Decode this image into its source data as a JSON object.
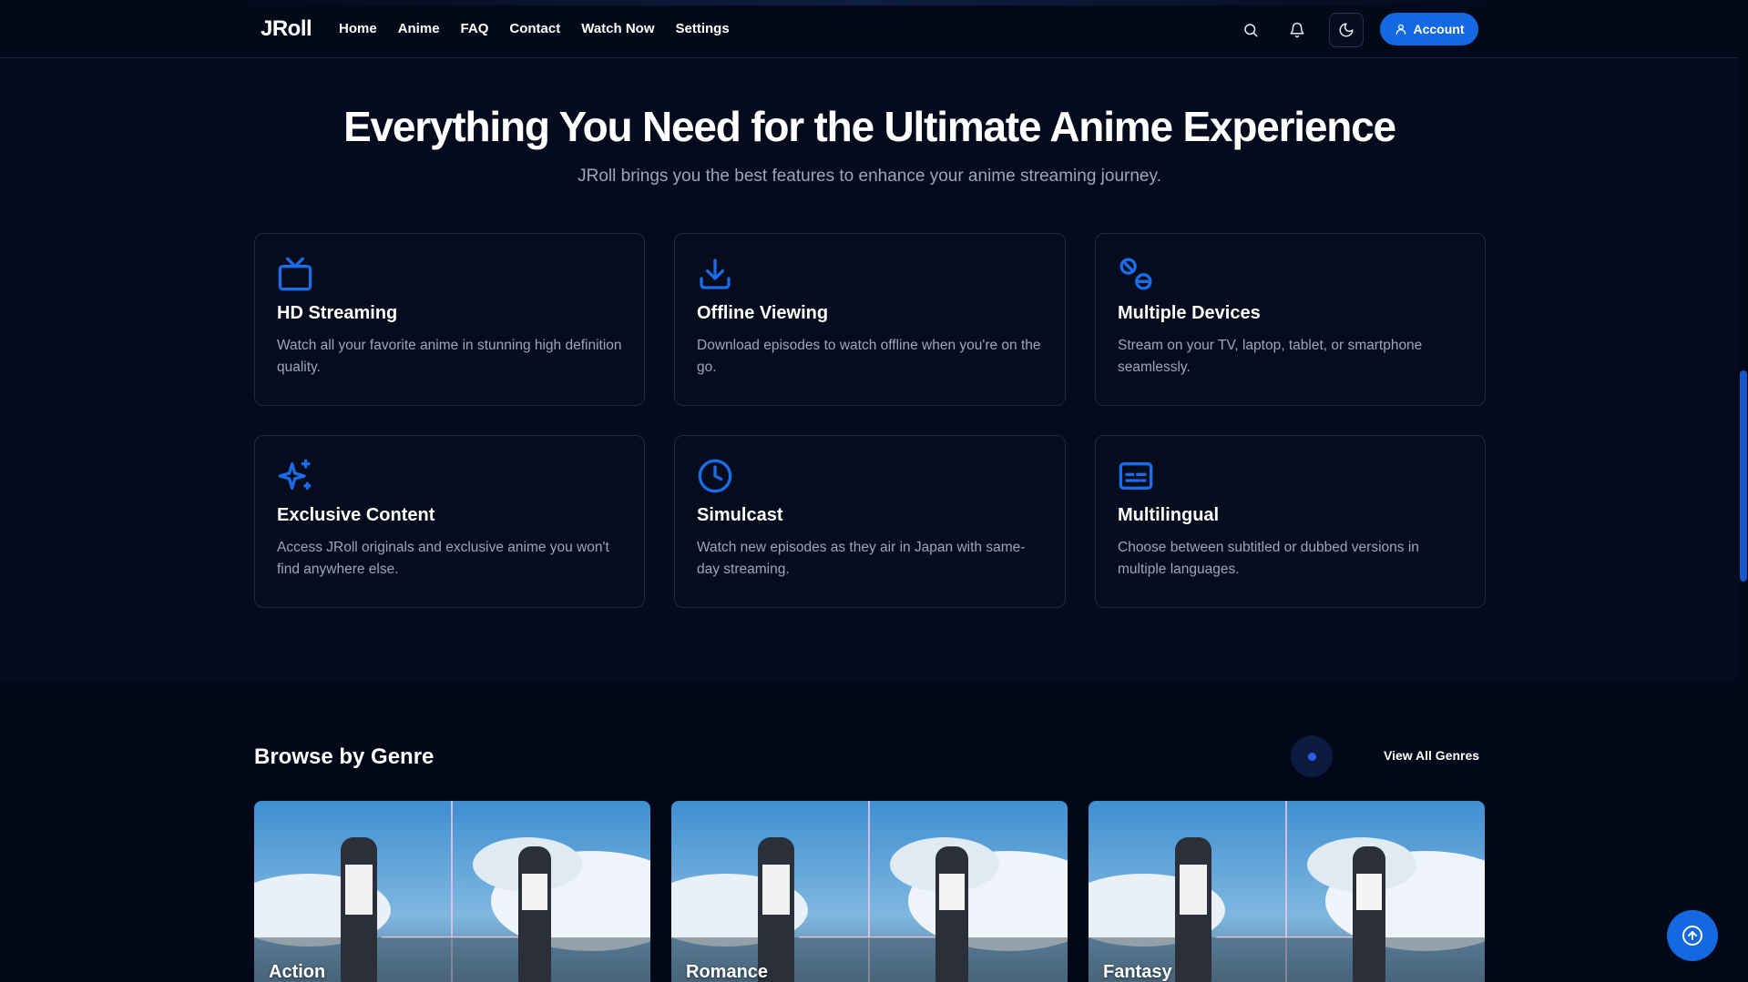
{
  "header": {
    "logo": "JRoll",
    "nav": [
      "Home",
      "Anime",
      "FAQ",
      "Contact",
      "Watch Now",
      "Settings"
    ],
    "icons": [
      "search-icon",
      "bell-icon",
      "moon-icon"
    ],
    "account_label": "Account",
    "accent": "#1469e3"
  },
  "hero": {
    "title": "Everything You Need for the Ultimate Anime Experience",
    "subtitle": "JRoll brings you the best features to enhance your anime streaming journey."
  },
  "features": [
    {
      "icon": "tv-icon",
      "title": "HD Streaming",
      "desc": "Watch all your favorite anime in stunning high definition quality."
    },
    {
      "icon": "download-icon",
      "title": "Offline Viewing",
      "desc": "Download episodes to watch offline when you're on the go."
    },
    {
      "icon": "devices-icon",
      "title": "Multiple Devices",
      "desc": "Stream on your TV, laptop, tablet, or smartphone seamlessly."
    },
    {
      "icon": "sparkles-icon",
      "title": "Exclusive Content",
      "desc": "Access JRoll originals and exclusive anime you won't find anywhere else."
    },
    {
      "icon": "clock-icon",
      "title": "Simulcast",
      "desc": "Watch new episodes as they air in Japan with same-day streaming."
    },
    {
      "icon": "subtitles-icon",
      "title": "Multilingual",
      "desc": "Choose between subtitled or dubbed versions in multiple languages."
    }
  ],
  "genres": {
    "title": "Browse by Genre",
    "view_all": "View All Genres",
    "items": [
      "Action",
      "Romance",
      "Fantasy"
    ]
  },
  "fab_icon": "arrow-up-circle-icon"
}
